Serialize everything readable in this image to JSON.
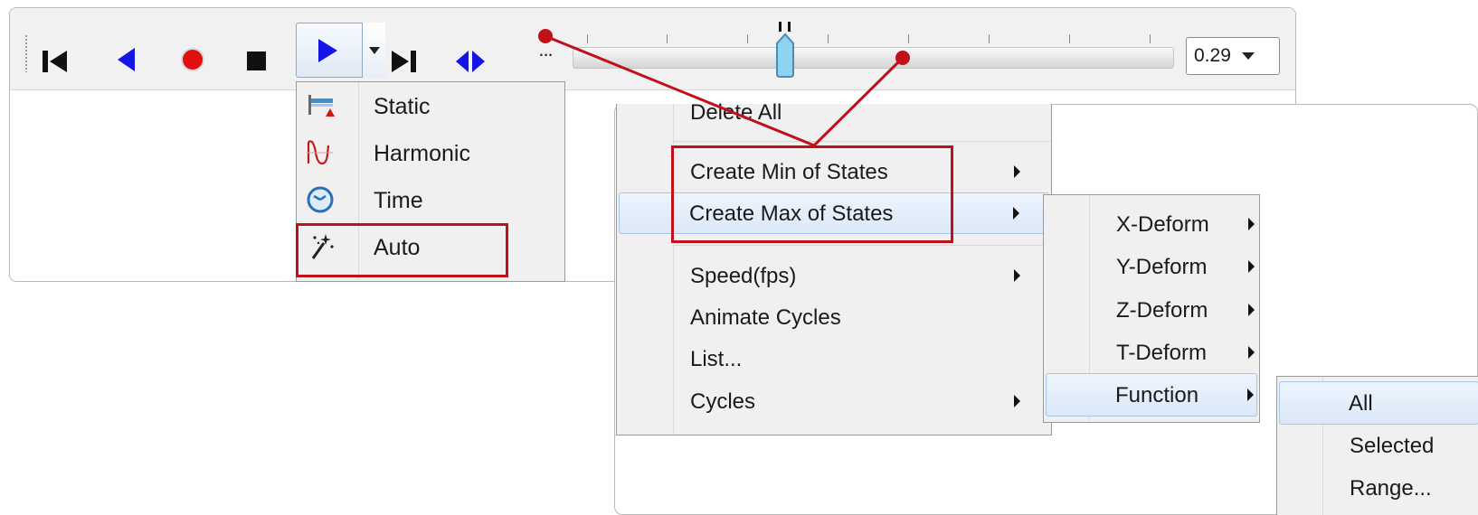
{
  "toolbar": {
    "buttons": [
      {
        "icon": "skip-to-start-icon"
      },
      {
        "icon": "step-back-icon"
      },
      {
        "icon": "record-icon"
      },
      {
        "icon": "stop-icon"
      },
      {
        "icon": "play-icon"
      },
      {
        "icon": "skip-to-end-icon"
      },
      {
        "icon": "step-both-icon"
      }
    ],
    "more_label": "...",
    "slider_value": 0.29,
    "frame_value": "0.29"
  },
  "mode_menu": {
    "items": [
      {
        "label": "Static",
        "icon": "static-icon"
      },
      {
        "label": "Harmonic",
        "icon": "harmonic-icon"
      },
      {
        "label": "Time",
        "icon": "time-icon"
      },
      {
        "label": "Auto",
        "icon": "magic-wand-icon"
      }
    ]
  },
  "context_menu": {
    "items": [
      {
        "label": "Delete All"
      },
      {
        "label": "Create Min of States",
        "submenu": true
      },
      {
        "label": "Create Max of States",
        "submenu": true
      },
      {
        "label": "Speed(fps)",
        "submenu": true
      },
      {
        "label": "Animate Cycles"
      },
      {
        "label": "List..."
      },
      {
        "label": "Cycles",
        "submenu": true
      }
    ]
  },
  "deform_submenu": {
    "items": [
      {
        "label": "X-Deform",
        "submenu": true
      },
      {
        "label": "Y-Deform",
        "submenu": true
      },
      {
        "label": "Z-Deform",
        "submenu": true
      },
      {
        "label": "T-Deform",
        "submenu": true
      },
      {
        "label": "Function",
        "submenu": true
      }
    ]
  },
  "function_submenu": {
    "items": [
      {
        "label": "All"
      },
      {
        "label": "Selected"
      },
      {
        "label": "Range..."
      }
    ]
  },
  "colors": {
    "accent_blue": "#1414e6",
    "record_red": "#e01010",
    "callout_red": "#c0101a",
    "highlight": "#dbe8f8"
  }
}
